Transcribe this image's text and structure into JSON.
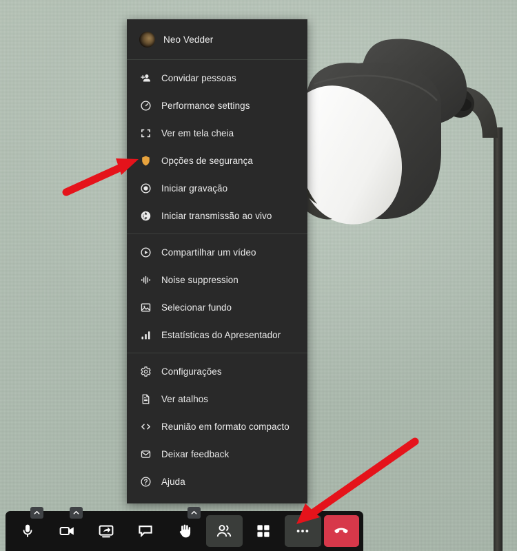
{
  "window": {
    "background_color": "#b2c0b4",
    "scene": "video-call background showing a dark desk lamp against a sage green wall"
  },
  "menu": {
    "profile": {
      "name": "Neo Vedder",
      "avatar_icon": "user-avatar"
    },
    "sections": [
      {
        "items": [
          {
            "label": "Convidar pessoas",
            "icon": "add-person-icon"
          },
          {
            "label": "Performance settings",
            "icon": "speedometer-icon"
          },
          {
            "label": "Ver em tela cheia",
            "icon": "fullscreen-icon"
          },
          {
            "label": "Opções de segurança",
            "icon": "shield-icon",
            "icon_color": "#e8a33d"
          },
          {
            "label": "Iniciar gravação",
            "icon": "record-icon"
          },
          {
            "label": "Iniciar transmissão ao vivo",
            "icon": "live-stream-icon"
          }
        ]
      },
      {
        "items": [
          {
            "label": "Compartilhar um vídeo",
            "icon": "play-circle-icon"
          },
          {
            "label": "Noise suppression",
            "icon": "waveform-icon"
          },
          {
            "label": "Selecionar fundo",
            "icon": "image-icon"
          },
          {
            "label": "Estatísticas do Apresentador",
            "icon": "bar-chart-icon"
          }
        ]
      },
      {
        "items": [
          {
            "label": "Configurações",
            "icon": "gear-icon"
          },
          {
            "label": "Ver atalhos",
            "icon": "document-icon"
          },
          {
            "label": "Reunião em formato compacto",
            "icon": "code-brackets-icon"
          },
          {
            "label": "Deixar feedback",
            "icon": "envelope-icon"
          },
          {
            "label": "Ajuda",
            "icon": "question-circle-icon"
          }
        ]
      }
    ]
  },
  "toolbar": {
    "buttons": [
      {
        "name": "microphone",
        "icon": "microphone-icon",
        "has_chevron": true,
        "state": "default"
      },
      {
        "name": "camera",
        "icon": "video-camera-icon",
        "has_chevron": true,
        "state": "default"
      },
      {
        "name": "screen-share",
        "icon": "screen-share-icon",
        "has_chevron": false,
        "state": "default"
      },
      {
        "name": "chat",
        "icon": "chat-bubble-icon",
        "has_chevron": false,
        "state": "default"
      },
      {
        "name": "raise-hand",
        "icon": "raised-hand-icon",
        "has_chevron": true,
        "state": "default"
      },
      {
        "name": "participants",
        "icon": "people-icon",
        "has_chevron": false,
        "state": "active"
      },
      {
        "name": "tile-view",
        "icon": "grid-view-icon",
        "has_chevron": false,
        "state": "default"
      },
      {
        "name": "more-options",
        "icon": "ellipsis-icon",
        "has_chevron": false,
        "state": "active"
      },
      {
        "name": "hangup",
        "icon": "phone-hangup-icon",
        "has_chevron": false,
        "state": "danger"
      }
    ],
    "hangup_color": "#d7384a"
  },
  "annotations": {
    "arrow_color": "#e5131b",
    "arrows": [
      {
        "name": "arrow-to-security-options",
        "points_to": "Opções de segurança"
      },
      {
        "name": "arrow-to-more-options",
        "points_to": "more-options"
      }
    ]
  }
}
